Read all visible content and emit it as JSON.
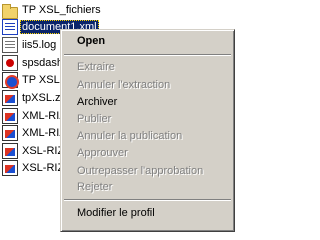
{
  "files": [
    {
      "name": "TP XSL_fichiers",
      "icon": "folder-icon",
      "selected": false
    },
    {
      "name": "document1.xml",
      "icon": "xml-file-icon",
      "selected": true
    },
    {
      "name": "iis5.log",
      "icon": "log-file-icon",
      "selected": false
    },
    {
      "name": "spsdash",
      "icon": "spss-file-icon",
      "selected": false
    },
    {
      "name": "TP XSL.",
      "icon": "tp-document-icon",
      "selected": false
    },
    {
      "name": "tpXSL.zi",
      "icon": "xsl-document-icon",
      "selected": false
    },
    {
      "name": "XML-RIZ",
      "icon": "xsl-document-icon",
      "selected": false
    },
    {
      "name": "XML-RIZ",
      "icon": "xsl-document-icon",
      "selected": false
    },
    {
      "name": "XSL-RIZ",
      "icon": "xsl-document-icon",
      "selected": false
    },
    {
      "name": "XSL-RIZ",
      "icon": "xsl-document-icon",
      "selected": false
    }
  ],
  "context_menu": {
    "open": "Open",
    "extract": "Extraire",
    "cancel_extract": "Annuler l'extraction",
    "archive": "Archiver",
    "publish": "Publier",
    "cancel_publish": "Annuler la publication",
    "approve": "Approuver",
    "override_approve": "Outrepasser l'approbation",
    "reject": "Rejeter",
    "modify_profile": "Modifier le profil"
  }
}
